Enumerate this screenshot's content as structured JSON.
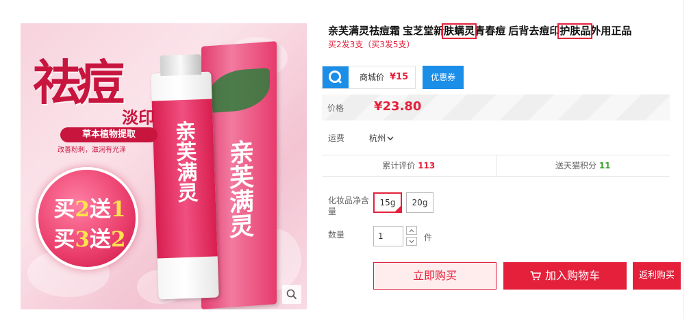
{
  "image": {
    "big_title": "祛痘",
    "subtitle": "淡印",
    "herbal": "草本植物提取",
    "herbal_sub": "改善粉刺，滋润有光泽",
    "promo_line1_a": "买",
    "promo_line1_b": "2",
    "promo_line1_c": "送",
    "promo_line1_d": "1",
    "promo_line2_a": "买",
    "promo_line2_b": "3",
    "promo_line2_c": "送",
    "promo_line2_d": "2",
    "box_text": "亲芙满灵",
    "tube_text": "亲芙满灵"
  },
  "product": {
    "title_part1": "亲芙满灵祛痘霜 宝芝堂新",
    "title_hl1": "肤螨灵",
    "title_part2": "青春痘 后背去痘印",
    "title_hl2": "护肤品",
    "title_part3": "外用正品",
    "subtitle": "买2发3支（买3发5支）"
  },
  "mall": {
    "label": "商城价",
    "price": "¥15",
    "coupon": "优惠券"
  },
  "price": {
    "label": "价格",
    "value": "¥23.80"
  },
  "shipping": {
    "label": "运费",
    "city": "杭州"
  },
  "stats": {
    "reviews_label": "累计评价",
    "reviews_count": "113",
    "points_label": "送天猫积分",
    "points_count": "11"
  },
  "size": {
    "label": "化妆品净含量",
    "options": [
      "15g",
      "20g"
    ],
    "selected": "15g"
  },
  "quantity": {
    "label": "数量",
    "value": "1",
    "unit": "件"
  },
  "actions": {
    "buy_now": "立即购买",
    "add_cart": "加入购物车",
    "rebate": "返利购买"
  },
  "colors": {
    "accent": "#e4203b",
    "mall_blue": "#1b8ee8",
    "green": "#399e2e"
  }
}
